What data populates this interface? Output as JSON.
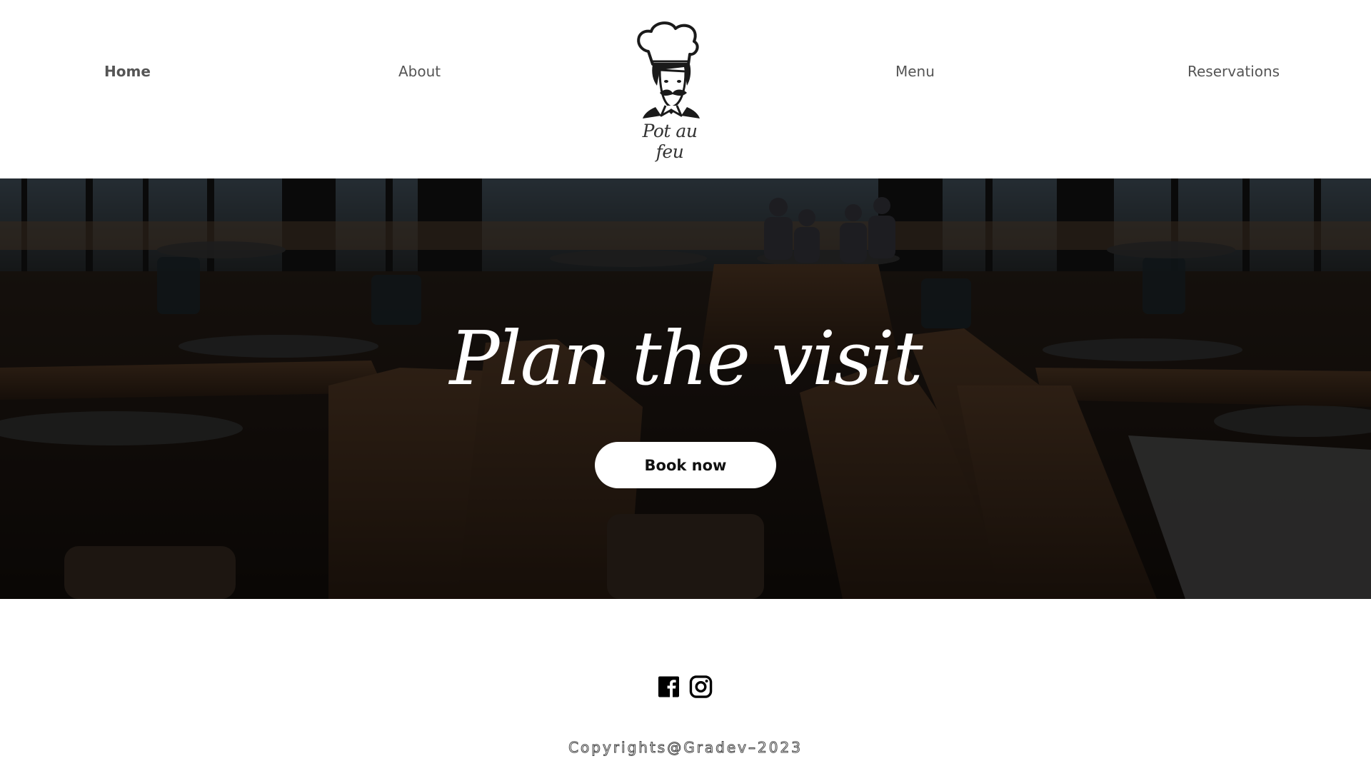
{
  "nav": {
    "home": "Home",
    "about": "About",
    "menu": "Menu",
    "reservations": "Reservations",
    "active": "home"
  },
  "logo": {
    "caption": "Pot au feu",
    "icon": "chef-icon"
  },
  "hero": {
    "title": "Plan the visit",
    "button_label": "Book now"
  },
  "footer": {
    "social": [
      "facebook-icon",
      "instagram-icon"
    ],
    "copyright": "Copyrights@Gradev–2023"
  },
  "colors": {
    "nav_text": "#555555",
    "hero_overlay": "#1a130e",
    "button_bg": "#ffffff",
    "button_text": "#111111"
  }
}
